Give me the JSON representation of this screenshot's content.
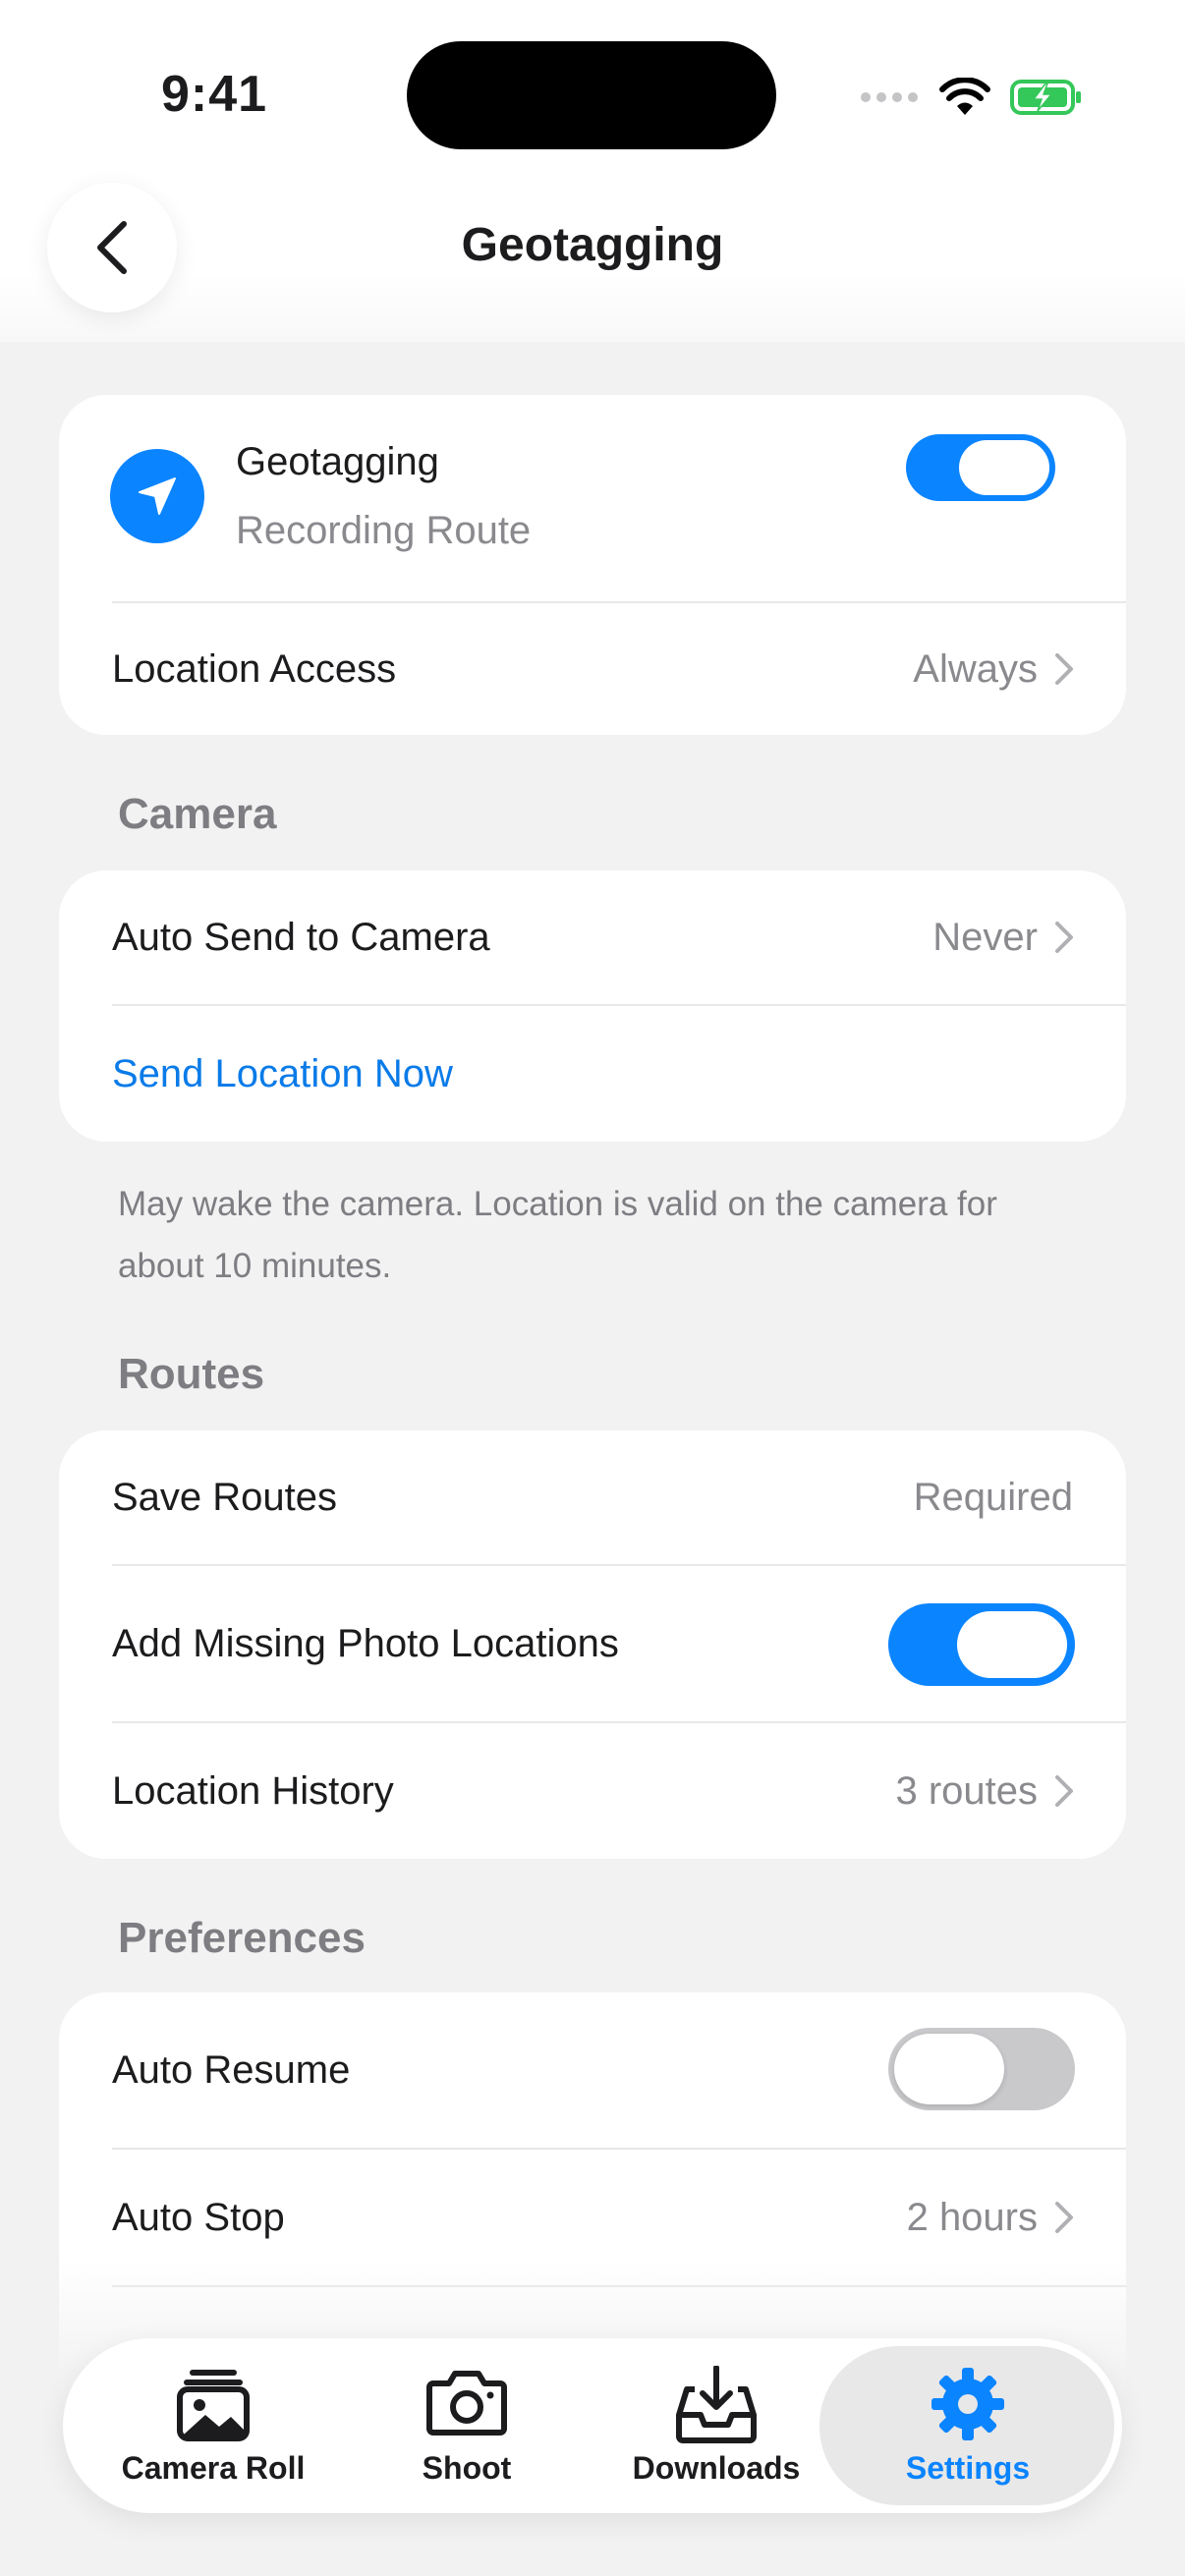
{
  "status_bar": {
    "time": "9:41"
  },
  "header": {
    "title": "Geotagging"
  },
  "geotagging_card": {
    "title": "Geotagging",
    "subtitle": "Recording Route",
    "toggle_on": true,
    "location_access_label": "Location Access",
    "location_access_value": "Always"
  },
  "camera_section": {
    "title": "Camera",
    "auto_send_label": "Auto Send to Camera",
    "auto_send_value": "Never",
    "send_now_label": "Send Location Now",
    "footnote": "May wake the camera. Location is valid on the camera for about 10 minutes."
  },
  "routes_section": {
    "title": "Routes",
    "save_routes_label": "Save Routes",
    "save_routes_value": "Required",
    "add_missing_label": "Add Missing Photo Locations",
    "add_missing_on": true,
    "history_label": "Location History",
    "history_value": "3 routes"
  },
  "preferences_section": {
    "title": "Preferences",
    "auto_resume_label": "Auto Resume",
    "auto_resume_on": false,
    "auto_stop_label": "Auto Stop",
    "auto_stop_value": "2 hours"
  },
  "tabbar": {
    "tabs": [
      {
        "label": "Camera Roll",
        "icon": "photo-stack-icon"
      },
      {
        "label": "Shoot",
        "icon": "camera-icon"
      },
      {
        "label": "Downloads",
        "icon": "download-tray-icon"
      },
      {
        "label": "Settings",
        "icon": "gear-icon",
        "active": true
      }
    ]
  },
  "colors": {
    "accent": "#0a84ff",
    "link": "#0a7be8",
    "background": "#f2f2f2"
  }
}
